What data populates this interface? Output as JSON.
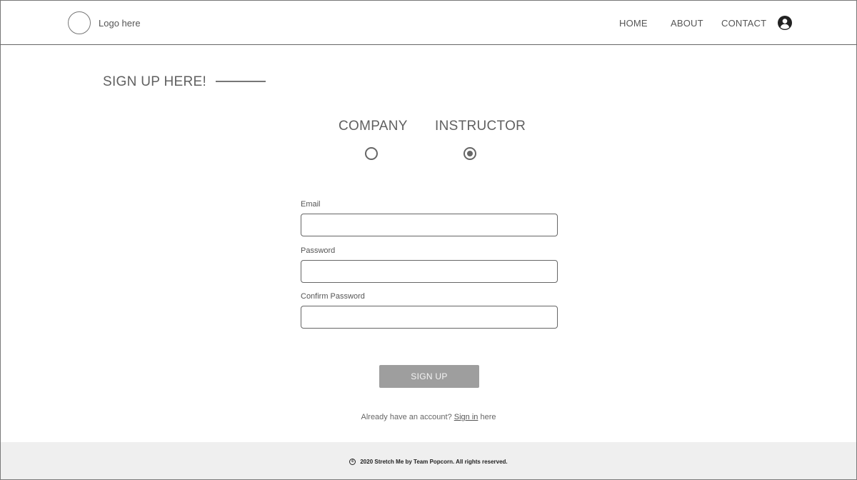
{
  "header": {
    "logo_text": "Logo here",
    "nav": {
      "home": "HOME",
      "about": "ABOUT",
      "contact": "CONTACT"
    },
    "user_icon": "user-circle-icon"
  },
  "signup": {
    "title": "SIGN UP HERE!",
    "roles": {
      "company": "COMPANY",
      "instructor": "INSTRUCTOR",
      "selected": "INSTRUCTOR"
    },
    "fields": {
      "email_label": "Email",
      "email_value": "",
      "password_label": "Password",
      "password_value": "",
      "confirm_label": "Confirm Password",
      "confirm_value": ""
    },
    "button_label": "SIGN UP",
    "signin_prefix": "Already have an account?",
    "signin_link": "Sign in",
    "signin_suffix": "here"
  },
  "footer": {
    "copyright_icon": "copyright-icon",
    "copyright_symbol": "c",
    "text": "2020 Stretch Me by Team Popcorn. All rights reserved."
  },
  "colors": {
    "button_bg": "#9e9e9e",
    "footer_bg": "#efefef",
    "border": "#666666"
  }
}
